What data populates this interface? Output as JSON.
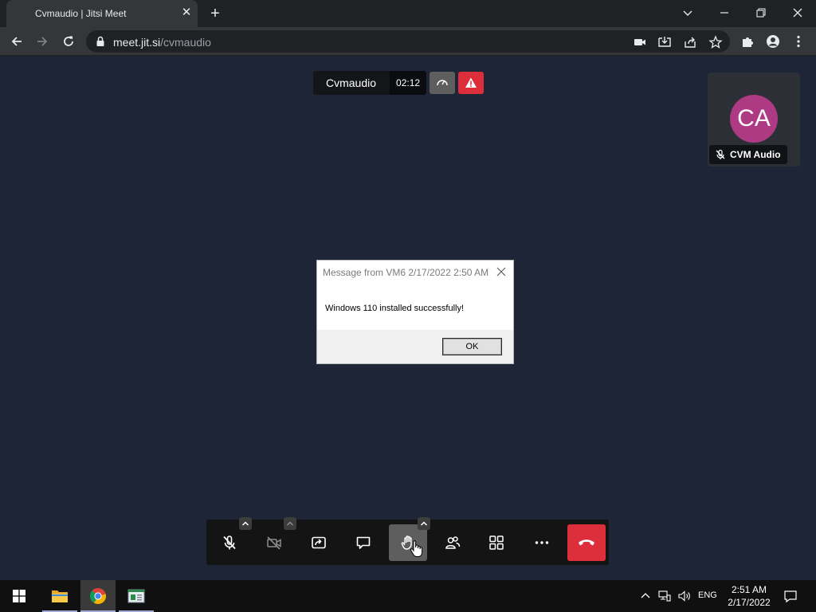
{
  "browser": {
    "tab_title": "Cvmaudio | Jitsi Meet",
    "tab_close": "✕",
    "new_tab": "+",
    "url_host": "meet.jit.si",
    "url_path": "/cvmaudio"
  },
  "meeting": {
    "subject": "Cvmaudio",
    "timer": "02:12",
    "participant_initials": "CA",
    "participant_name": "CVM Audio",
    "colors": {
      "background": "#1d2536",
      "avatar": "#ae3a84",
      "hangup": "#dd2e3c",
      "warning": "#dd2e3c"
    }
  },
  "dialog": {
    "title": "Message from VM6 2/17/2022 2:50 AM",
    "message": "Windows 110 installed successfully!",
    "ok_label": "OK"
  },
  "toolbox": {
    "buttons": [
      "mic-muted",
      "camera-off",
      "share-screen",
      "chat",
      "raise-hand",
      "participants",
      "tile-view",
      "more",
      "hangup"
    ],
    "active": "raise-hand"
  },
  "taskbar": {
    "apps": [
      "file-explorer",
      "chrome",
      "remote-desktop"
    ],
    "language": "ENG",
    "time": "2:51 AM",
    "date": "2/17/2022"
  }
}
